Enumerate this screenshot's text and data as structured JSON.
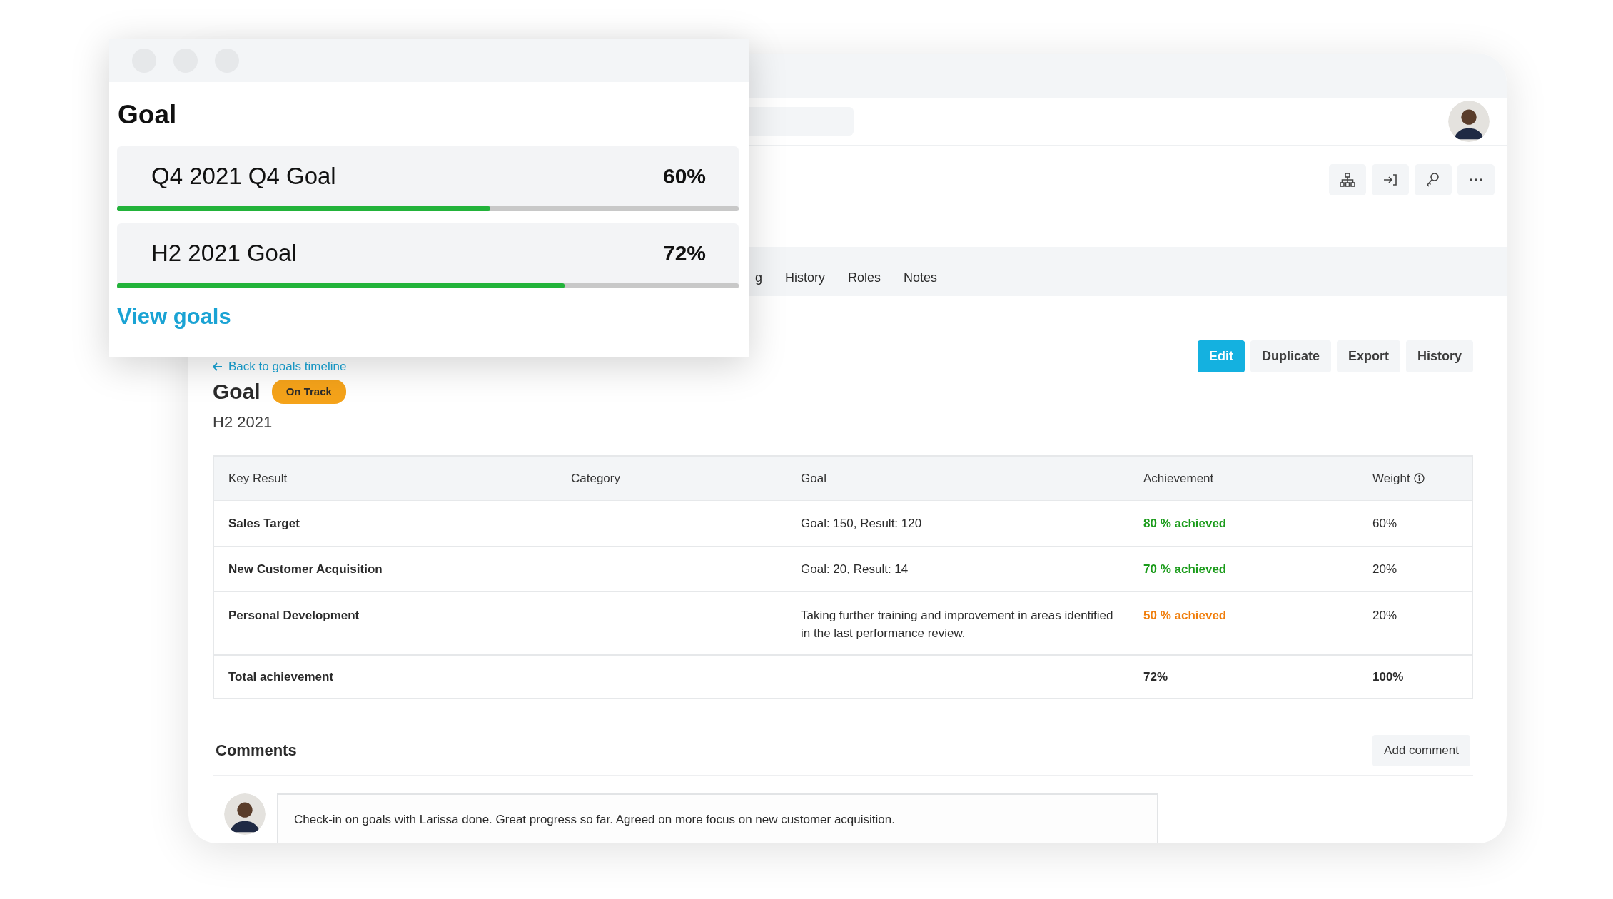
{
  "popup": {
    "title": "Goal",
    "goals": [
      {
        "name": "Q4 2021 Q4 Goal",
        "percent": "60%",
        "level": 0.6
      },
      {
        "name": "H2 2021 Goal",
        "percent": "72%",
        "level": 0.72
      }
    ],
    "link": "View goals"
  },
  "tabs": [
    {
      "label": "g",
      "selected": false
    },
    {
      "label": "History",
      "selected": false
    },
    {
      "label": "Roles",
      "selected": false
    },
    {
      "label": "Notes",
      "selected": false
    }
  ],
  "actions": [
    {
      "label": "Edit",
      "kind": "primary"
    },
    {
      "label": "Duplicate",
      "kind": "secondary"
    },
    {
      "label": "Export",
      "kind": "secondary"
    },
    {
      "label": "History",
      "kind": "secondary"
    }
  ],
  "back_link": "Back to goals timeline",
  "heading": "Goal",
  "status_badge": "On Track",
  "subtitle": "H2 2021",
  "table": {
    "columns": [
      "Key Result",
      "Category",
      "Goal",
      "Achievement",
      "Weight"
    ],
    "rows": [
      {
        "key_result": "Sales Target",
        "goal": "Goal: 150, Result: 120",
        "achievement": "80 % achieved",
        "color": "#1a9b1a",
        "weight": "60%"
      },
      {
        "key_result": "New Customer Acquisition",
        "goal": "Goal: 20, Result: 14",
        "achievement": "70 % achieved",
        "color": "#1a9b1a",
        "weight": "20%"
      },
      {
        "key_result": "Personal Development",
        "goal": "Taking further training and improvement in areas identified in the last performance review.",
        "achievement": "50 % achieved",
        "color": "#f07d0a",
        "weight": "20%"
      }
    ],
    "total": {
      "label": "Total achievement",
      "achievement": "72%",
      "weight": "100%"
    }
  },
  "comments": {
    "title": "Comments",
    "add_button": "Add comment",
    "items": [
      {
        "text": "Check-in on goals with Larissa done. Great progress so far. Agreed on more focus on new customer acquisition."
      }
    ]
  }
}
